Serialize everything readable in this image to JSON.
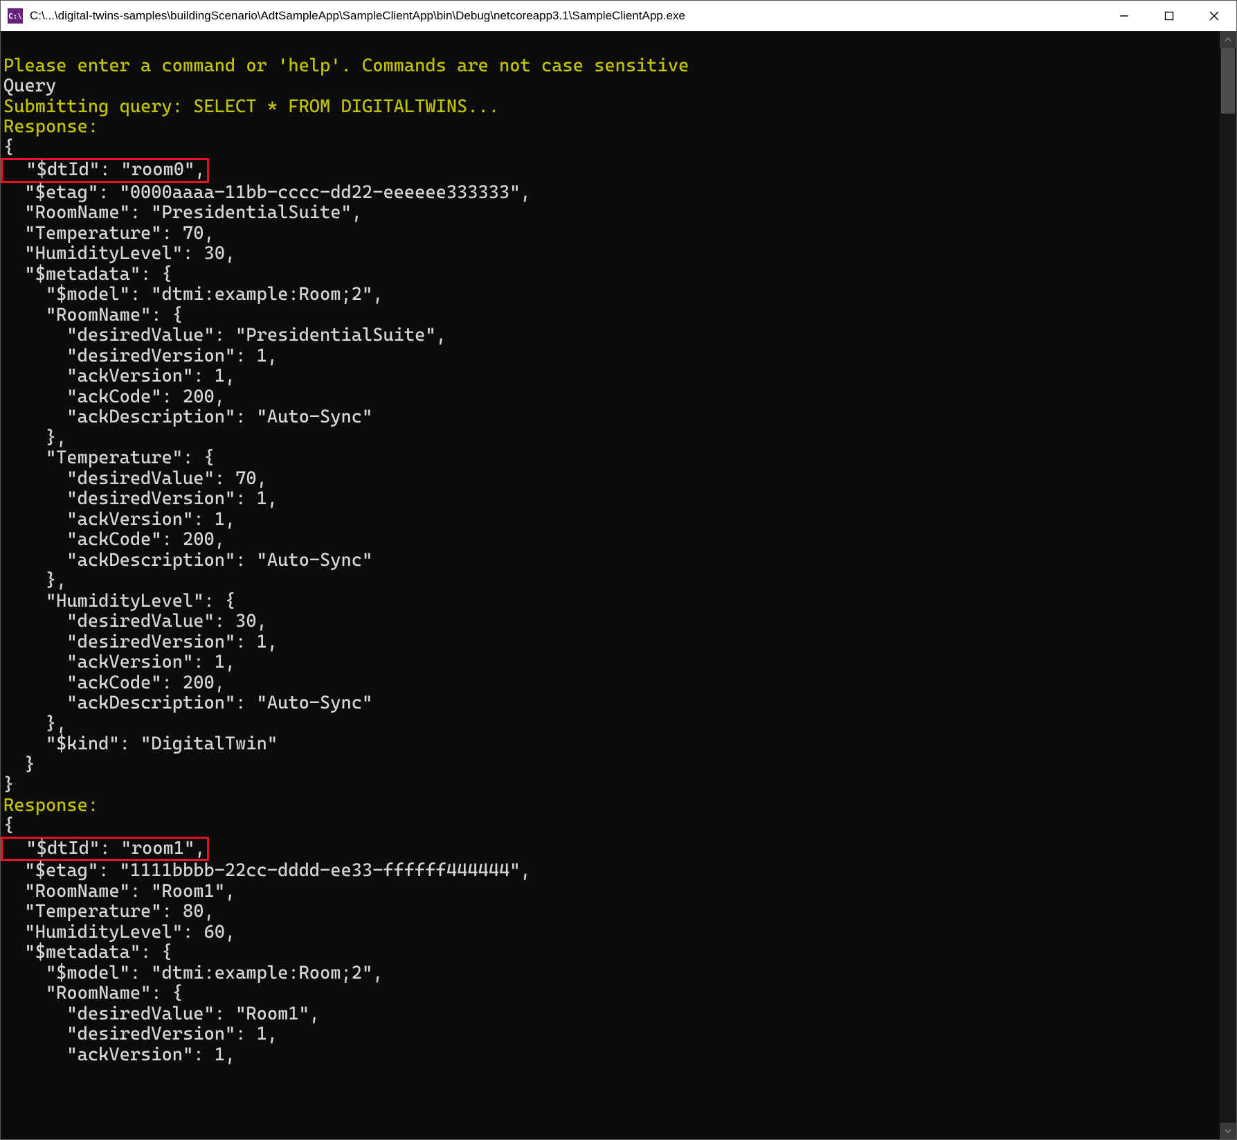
{
  "window": {
    "title": "C:\\...\\digital-twins-samples\\buildingScenario\\AdtSampleApp\\SampleClientApp\\bin\\Debug\\netcoreapp3.1\\SampleClientApp.exe",
    "app_icon_label": "C:\\"
  },
  "controls": {
    "minimize_title": "Minimize",
    "maximize_title": "Maximize",
    "close_title": "Close"
  },
  "term": {
    "l01": "Please enter a command or 'help'. Commands are not case sensitive",
    "l02": "Query",
    "l03": "Submitting query: SELECT * FROM DIGITALTWINS...",
    "l04": "Response:",
    "l05": "{",
    "l06": "  \"$dtId\": \"room0\",",
    "l07": "  \"$etag\": \"0000aaaa-11bb-cccc-dd22-eeeeee333333\",",
    "l08": "  \"RoomName\": \"PresidentialSuite\",",
    "l09": "  \"Temperature\": 70,",
    "l10": "  \"HumidityLevel\": 30,",
    "l11": "  \"$metadata\": {",
    "l12": "    \"$model\": \"dtmi:example:Room;2\",",
    "l13": "    \"RoomName\": {",
    "l14": "      \"desiredValue\": \"PresidentialSuite\",",
    "l15": "      \"desiredVersion\": 1,",
    "l16": "      \"ackVersion\": 1,",
    "l17": "      \"ackCode\": 200,",
    "l18": "      \"ackDescription\": \"Auto-Sync\"",
    "l19": "    },",
    "l20": "    \"Temperature\": {",
    "l21": "      \"desiredValue\": 70,",
    "l22": "      \"desiredVersion\": 1,",
    "l23": "      \"ackVersion\": 1,",
    "l24": "      \"ackCode\": 200,",
    "l25": "      \"ackDescription\": \"Auto-Sync\"",
    "l26": "    },",
    "l27": "    \"HumidityLevel\": {",
    "l28": "      \"desiredValue\": 30,",
    "l29": "      \"desiredVersion\": 1,",
    "l30": "      \"ackVersion\": 1,",
    "l31": "      \"ackCode\": 200,",
    "l32": "      \"ackDescription\": \"Auto-Sync\"",
    "l33": "    },",
    "l34": "    \"$kind\": \"DigitalTwin\"",
    "l35": "  }",
    "l36": "}",
    "l37": "Response:",
    "l38": "{",
    "l39": "  \"$dtId\": \"room1\",",
    "l40": "  \"$etag\": \"1111bbbb-22cc-dddd-ee33-ffffff444444\",",
    "l41": "  \"RoomName\": \"Room1\",",
    "l42": "  \"Temperature\": 80,",
    "l43": "  \"HumidityLevel\": 60,",
    "l44": "  \"$metadata\": {",
    "l45": "    \"$model\": \"dtmi:example:Room;2\",",
    "l46": "    \"RoomName\": {",
    "l47": "      \"desiredValue\": \"Room1\",",
    "l48": "      \"desiredVersion\": 1,",
    "l49": "      \"ackVersion\": 1,"
  }
}
